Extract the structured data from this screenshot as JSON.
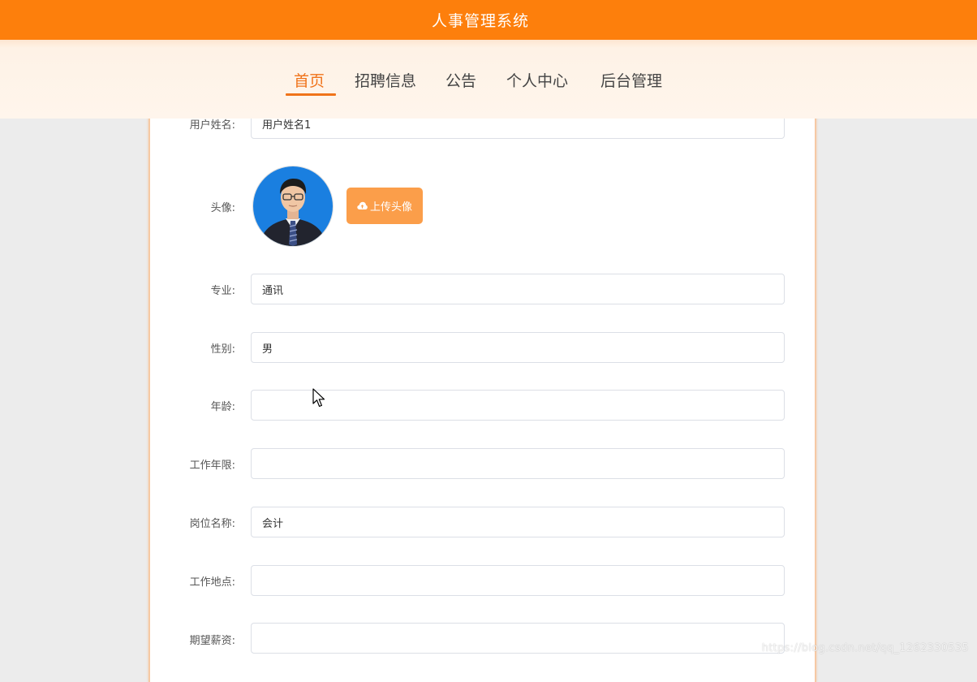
{
  "header": {
    "title": "人事管理系统"
  },
  "nav": {
    "items": [
      {
        "label": "首页",
        "active": true
      },
      {
        "label": "招聘信息",
        "active": false
      },
      {
        "label": "公告",
        "active": false
      },
      {
        "label": "个人中心",
        "active": false
      },
      {
        "label": "后台管理",
        "active": false
      }
    ]
  },
  "form": {
    "username": {
      "label": "用户姓名:",
      "value": "用户姓名1"
    },
    "avatar": {
      "label": "头像:",
      "upload_label": "上传头像"
    },
    "major": {
      "label": "专业:",
      "value": "通讯"
    },
    "gender": {
      "label": "性别:",
      "value": "男"
    },
    "age": {
      "label": "年龄:",
      "value": ""
    },
    "work_years": {
      "label": "工作年限:",
      "value": ""
    },
    "position": {
      "label": "岗位名称:",
      "value": "会计"
    },
    "location": {
      "label": "工作地点:",
      "value": ""
    },
    "salary": {
      "label": "期望薪资:",
      "value": ""
    }
  },
  "watermark": "https://blog.csdn.net/qq_1262330535",
  "colors": {
    "brand": "#fd7f0c",
    "accent": "#f0731a",
    "upload_button": "#fb9e4a"
  },
  "icons": {
    "upload": "cloud-upload-icon",
    "cursor": "mouse-pointer-icon"
  }
}
